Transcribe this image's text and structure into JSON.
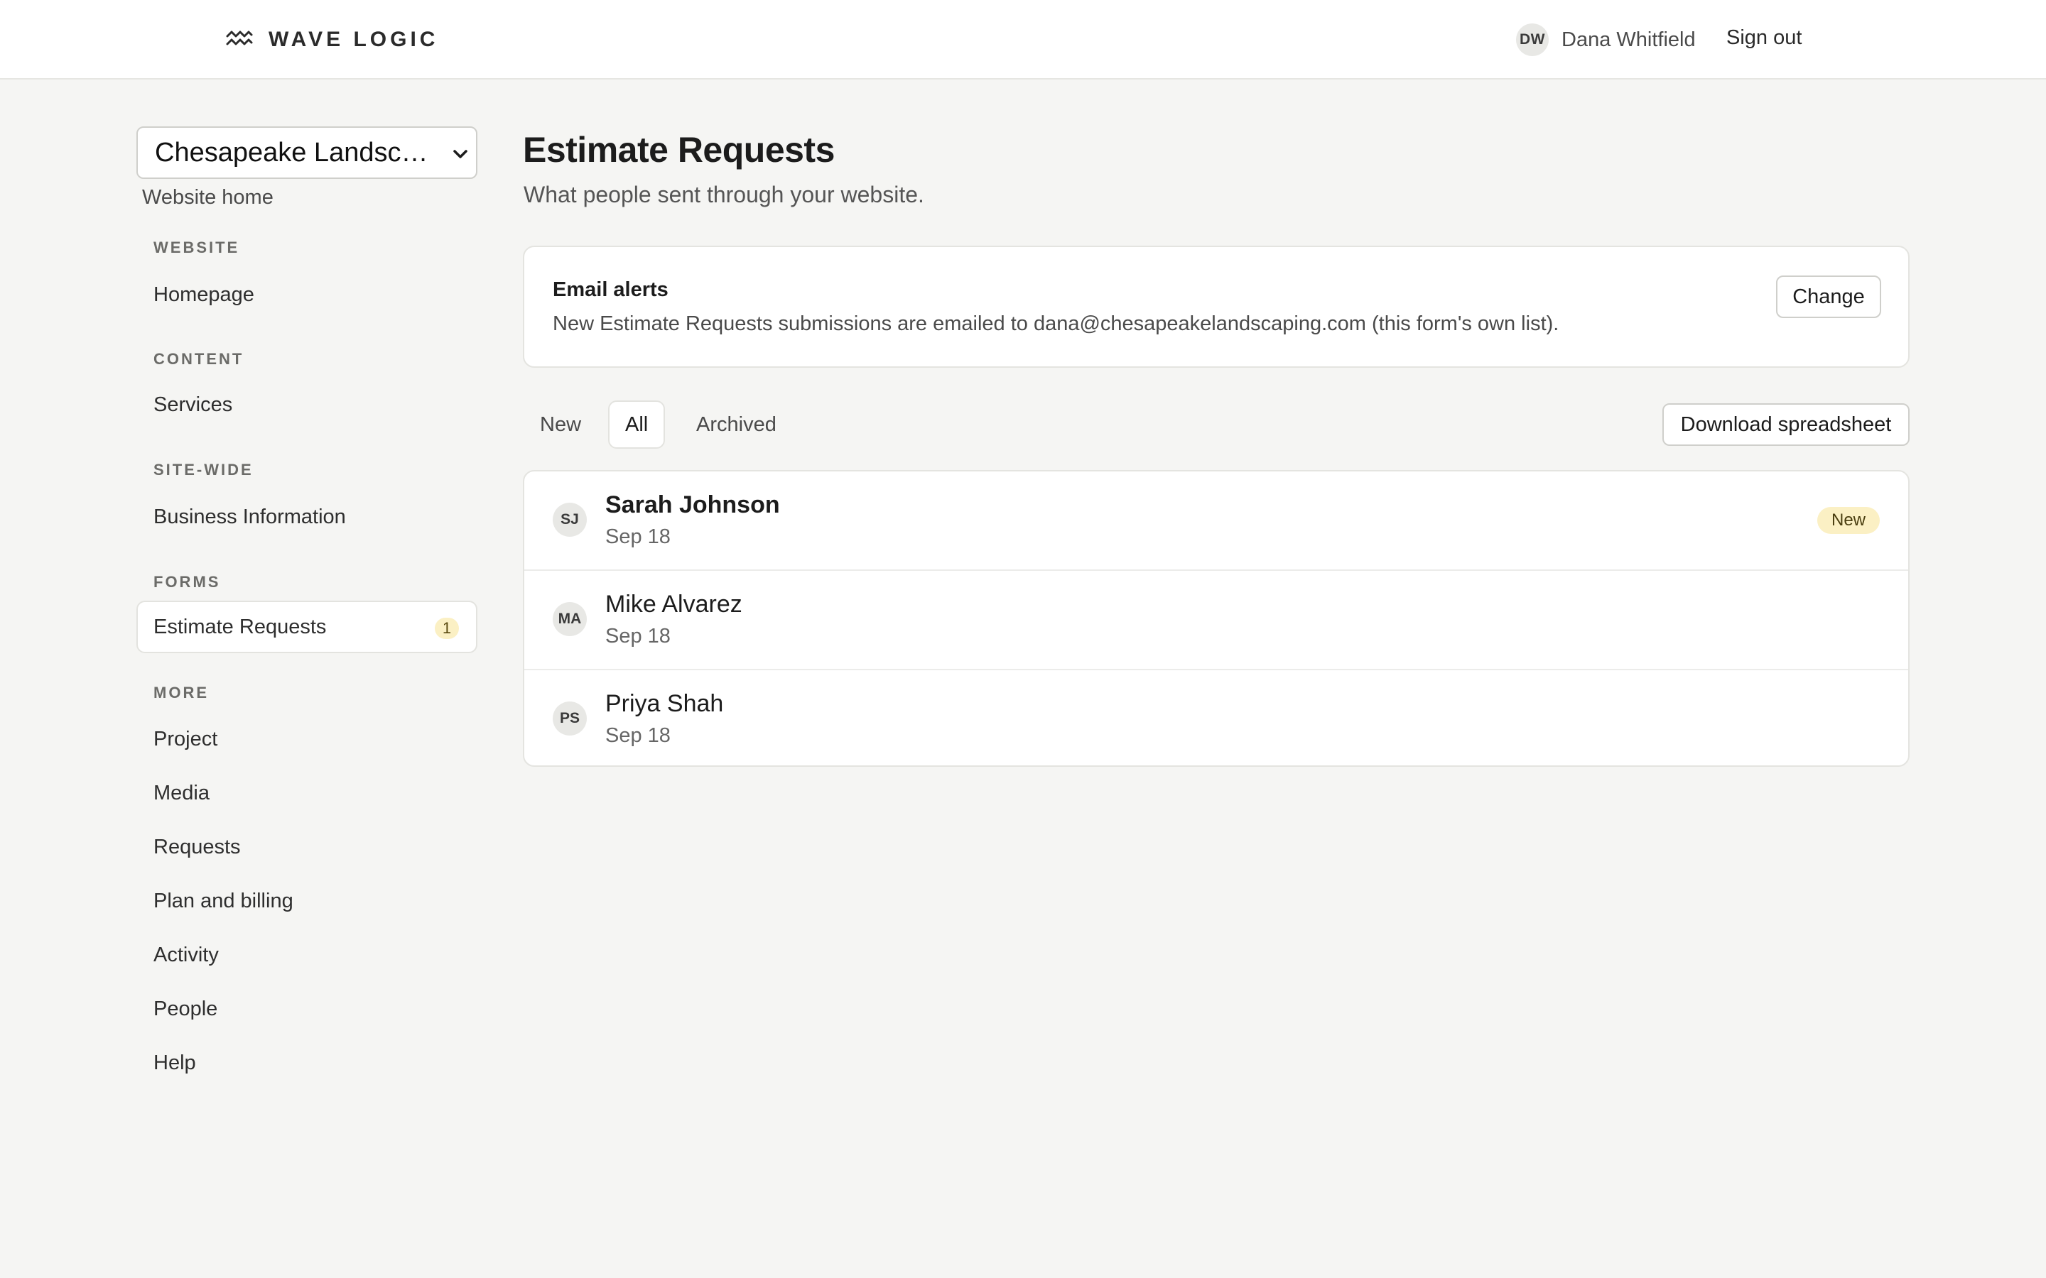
{
  "header": {
    "brand_name": "WAVE LOGIC",
    "brand_icon": "waves-icon",
    "user_initials": "DW",
    "user_name": "Dana Whitfield",
    "sign_out_label": "Sign out"
  },
  "sidebar": {
    "site_selector": {
      "selected": "Chesapeake Landscaping"
    },
    "website_home_label": "Website home",
    "sections": [
      {
        "label": "WEBSITE",
        "items": [
          {
            "label": "Homepage"
          }
        ]
      },
      {
        "label": "CONTENT",
        "items": [
          {
            "label": "Services"
          }
        ]
      },
      {
        "label": "SITE-WIDE",
        "items": [
          {
            "label": "Business Information"
          }
        ]
      },
      {
        "label": "FORMS",
        "items": [
          {
            "label": "Estimate Requests",
            "badge": "1",
            "active": true
          }
        ]
      },
      {
        "label": "MORE",
        "items": [
          {
            "label": "Project"
          },
          {
            "label": "Media"
          },
          {
            "label": "Requests"
          },
          {
            "label": "Plan and billing"
          },
          {
            "label": "Activity"
          },
          {
            "label": "People"
          },
          {
            "label": "Help"
          }
        ]
      }
    ]
  },
  "main": {
    "title": "Estimate Requests",
    "subtitle": "What people sent through your website.",
    "email_alerts": {
      "title": "Email alerts",
      "description": "New Estimate Requests submissions are emailed to dana@chesapeakelandscaping.com (this form's own list).",
      "change_label": "Change"
    },
    "tabs": [
      {
        "label": "New",
        "active": false
      },
      {
        "label": "All",
        "active": true
      },
      {
        "label": "Archived",
        "active": false
      }
    ],
    "download_label": "Download spreadsheet",
    "submissions": [
      {
        "initials": "SJ",
        "name": "Sarah Johnson",
        "date": "Sep 18",
        "status": "New",
        "unread": true
      },
      {
        "initials": "MA",
        "name": "Mike Alvarez",
        "date": "Sep 18",
        "status": "",
        "unread": false
      },
      {
        "initials": "PS",
        "name": "Priya Shah",
        "date": "Sep 18",
        "status": "",
        "unread": false
      }
    ]
  },
  "colors": {
    "background": "#f5f5f3",
    "surface": "#ffffff",
    "badge_bg": "#fbf0c4",
    "text": "#1c1c1c"
  }
}
